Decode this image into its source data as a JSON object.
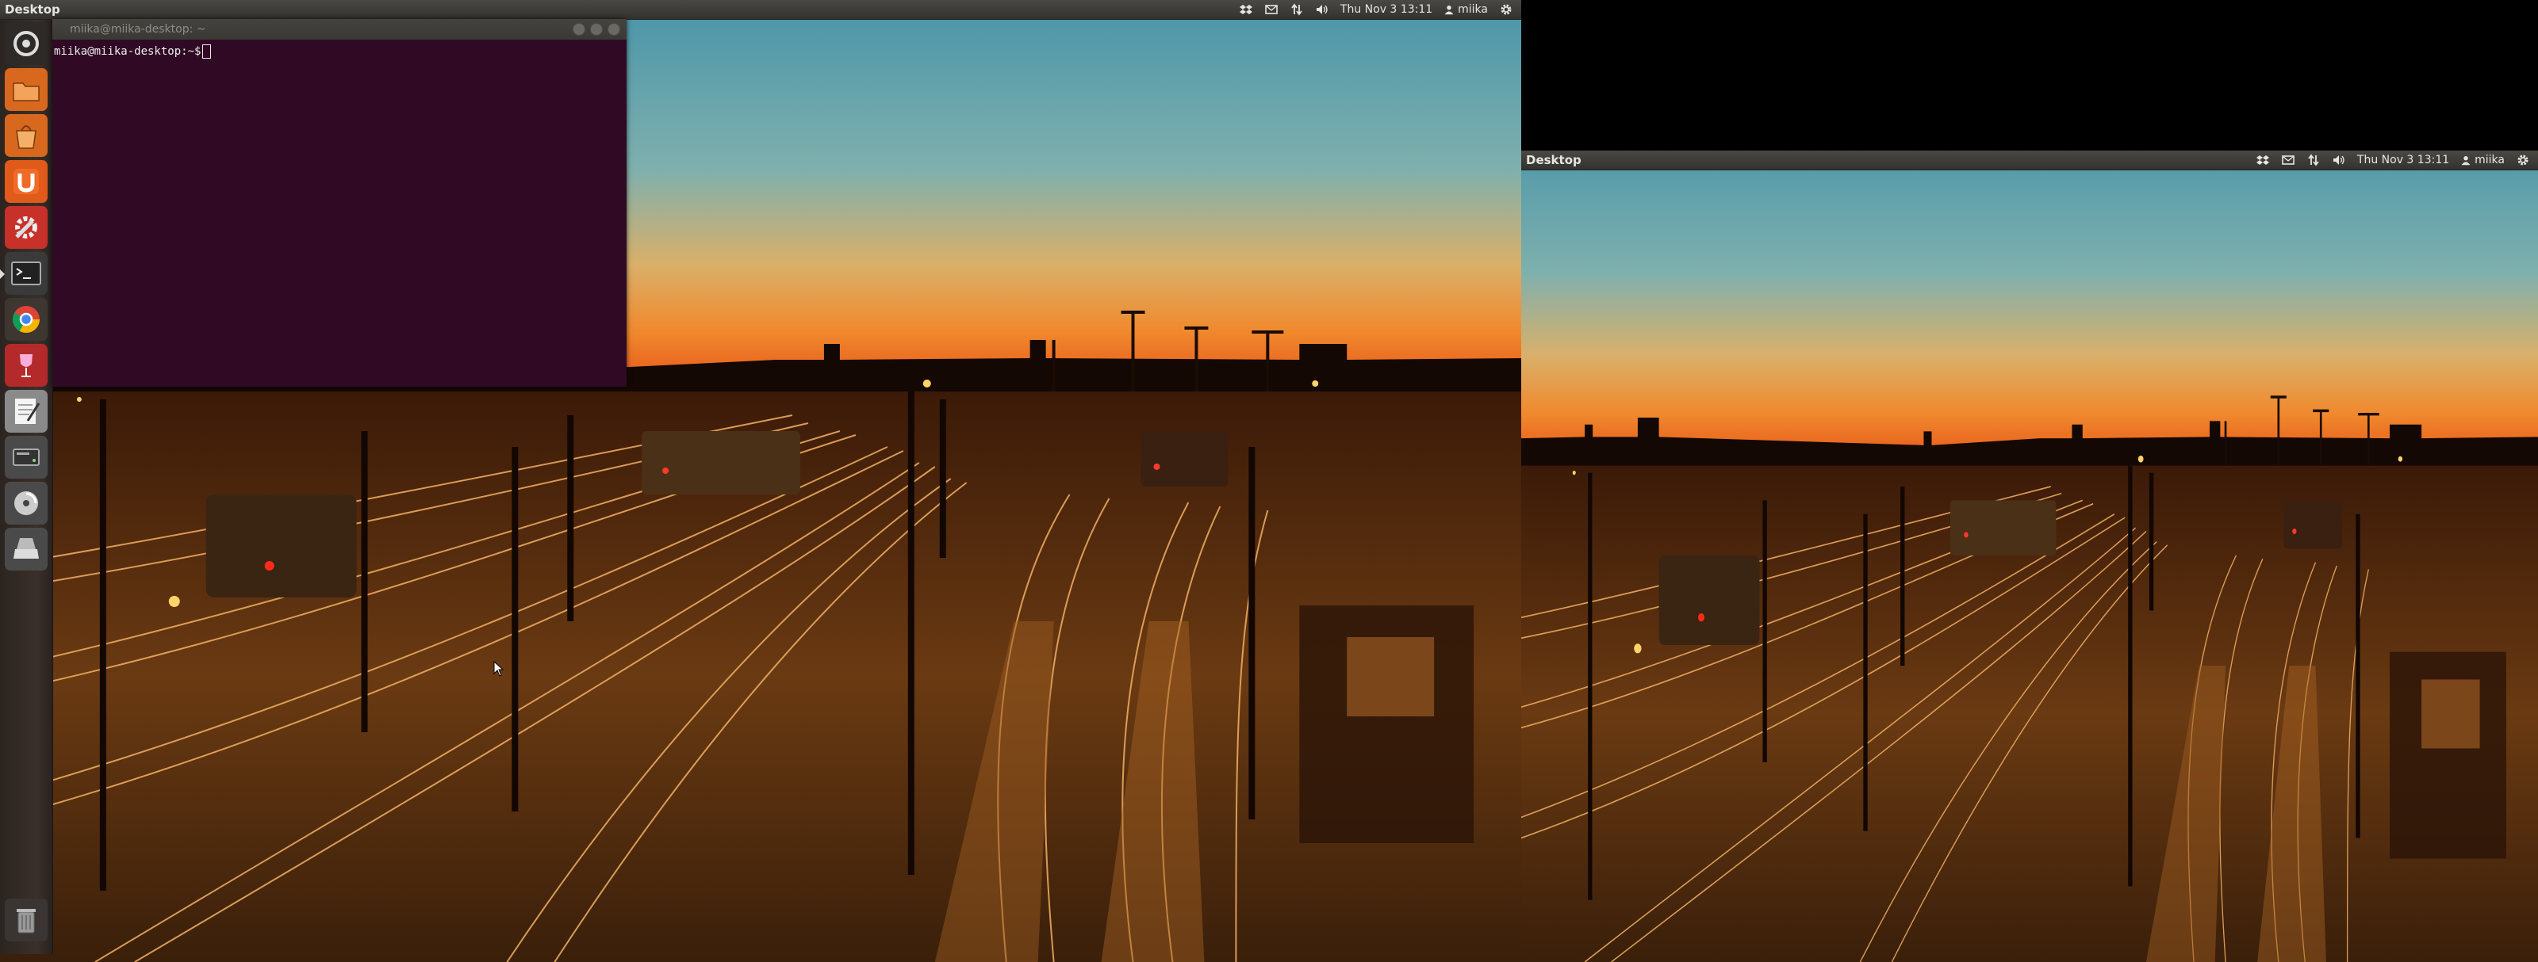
{
  "left_screen": {
    "panel": {
      "title": "Desktop",
      "clock": "Thu Nov 3 13:11",
      "user": "miika"
    },
    "terminal": {
      "title": "miika@miika-desktop: ~",
      "prompt": "miika@miika-desktop:~$"
    },
    "launcher": {
      "items": [
        "dash-home",
        "files",
        "software-center",
        "ubuntu-one",
        "system-settings",
        "terminal",
        "chrome",
        "wine",
        "text-editor",
        "disks",
        "startup-disk-creator",
        "scanner",
        "trash"
      ]
    }
  },
  "right_screen": {
    "panel": {
      "title": "Desktop",
      "clock": "Thu Nov 3 13:11",
      "user": "miika"
    }
  },
  "colors": {
    "panel": "#3c3b37",
    "terminal_bg": "#300a24",
    "launcher_bg": "#3a302a"
  }
}
